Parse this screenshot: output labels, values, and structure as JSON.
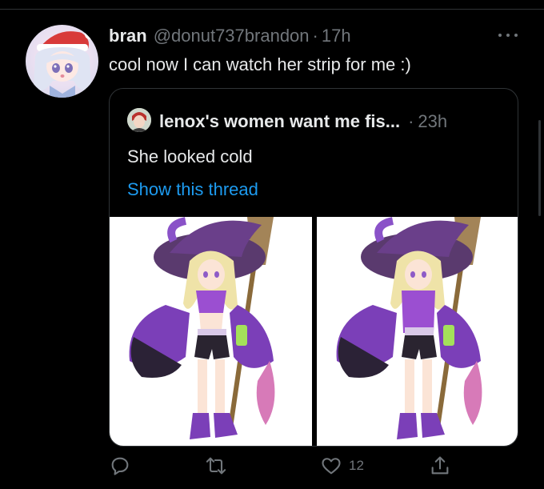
{
  "tweet": {
    "display_name": "bran",
    "handle": "@donut737brandon",
    "separator": "·",
    "time": "17h",
    "text": "cool now I can watch her strip for me :)"
  },
  "quoted": {
    "display_name": "lenox's women want me fis...",
    "separator": "·",
    "time": "23h",
    "text": "She looked cold",
    "thread_link": "Show this thread"
  },
  "actions": {
    "reply_icon": "reply-icon",
    "retweet_icon": "retweet-icon",
    "like_icon": "heart-icon",
    "like_count": "12",
    "share_icon": "share-icon"
  },
  "colors": {
    "background": "#000000",
    "text_primary": "#e7e9ea",
    "text_secondary": "#71767b",
    "link": "#1d9bf0",
    "border": "#2f3336",
    "witch_purple": "#7b3fb8",
    "hair_blonde": "#efe3a8"
  }
}
